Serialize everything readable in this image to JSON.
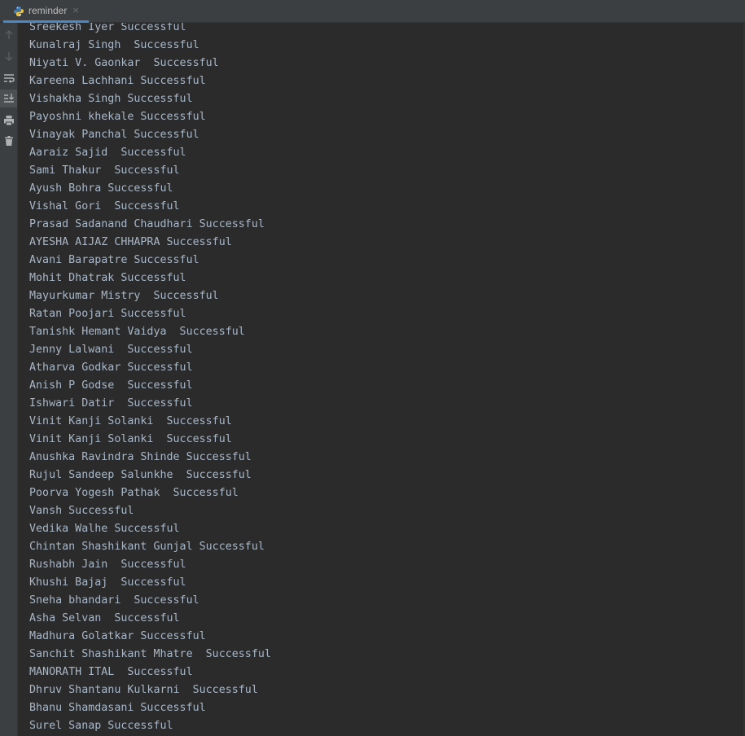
{
  "tab": {
    "title": "reminder",
    "close": "×",
    "icon": "python-icon"
  },
  "toolbar": {
    "buttons": [
      {
        "name": "up-arrow-icon"
      },
      {
        "name": "down-arrow-icon"
      },
      {
        "name": "soft-wrap-icon"
      },
      {
        "name": "scroll-to-end-icon",
        "active": true
      },
      {
        "name": "print-icon"
      },
      {
        "name": "trash-icon"
      }
    ]
  },
  "console": {
    "lines": [
      "Sreekesh Iyer Successful",
      "Kunalraj Singh  Successful",
      "Niyati V. Gaonkar  Successful",
      "Kareena Lachhani Successful",
      "Vishakha Singh Successful",
      "Payoshni khekale Successful",
      "Vinayak Panchal Successful",
      "Aaraiz Sajid  Successful",
      "Sami Thakur  Successful",
      "Ayush Bohra Successful",
      "Vishal Gori  Successful",
      "Prasad Sadanand Chaudhari Successful",
      "AYESHA AIJAZ CHHAPRA Successful",
      "Avani Barapatre Successful",
      "Mohit Dhatrak Successful",
      "Mayurkumar Mistry  Successful",
      "Ratan Poojari Successful",
      "Tanishk Hemant Vaidya  Successful",
      "Jenny Lalwani  Successful",
      "Atharva Godkar Successful",
      "Anish P Godse  Successful",
      "Ishwari Datir  Successful",
      "Vinit Kanji Solanki  Successful",
      "Vinit Kanji Solanki  Successful",
      "Anushka Ravindra Shinde Successful",
      "Rujul Sandeep Salunkhe  Successful",
      "Poorva Yogesh Pathak  Successful",
      "Vansh Successful",
      "Vedika Walhe Successful",
      "Chintan Shashikant Gunjal Successful",
      "Rushabh Jain  Successful",
      "Khushi Bajaj  Successful",
      "Sneha bhandari  Successful",
      "Asha Selvan  Successful",
      "Madhura Golatkar Successful",
      "Sanchit Shashikant Mhatre  Successful",
      "MANORATH ITAL  Successful",
      "Dhruv Shantanu Kulkarni  Successful",
      "Bhanu Shamdasani Successful",
      "Surel Sanap Successful"
    ]
  },
  "colors": {
    "background": "#2b2b2b",
    "panel": "#3c3f41",
    "text": "#a9b7c6",
    "tab_underline": "#4a88c7"
  }
}
